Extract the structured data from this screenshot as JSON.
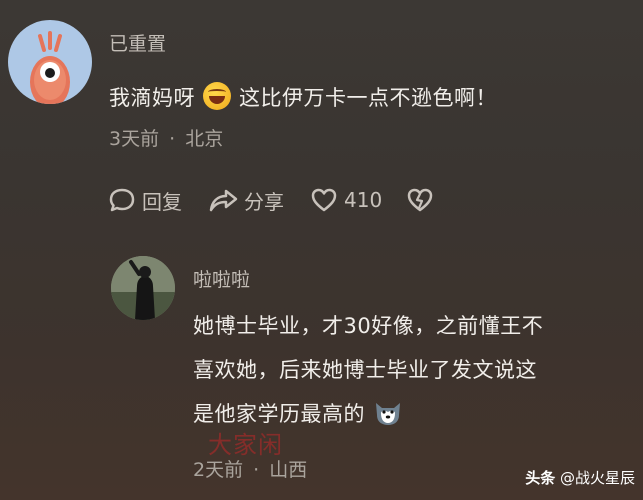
{
  "comment": {
    "author": "已重置",
    "text_before": "我滴妈呀",
    "emoji": "laugh-emoji",
    "text_after": "这比伊万卡一点不逊色啊！",
    "time": "3天前",
    "separator": "·",
    "location": "北京",
    "actions": {
      "reply_label": "回复",
      "share_label": "分享",
      "like_count": "410"
    }
  },
  "reply": {
    "author": "啦啦啦",
    "line1": "她博士毕业，才30好像，之前懂王不",
    "line2": "喜欢她，后来她博士毕业了发文说这",
    "line3": "是他家学历最高的",
    "emoji": "dog-emoji",
    "time": "2天前",
    "separator": "·",
    "location": "山西"
  },
  "watermark": "大家闲",
  "footer": {
    "brand": "头条",
    "account": "@战火星辰"
  }
}
